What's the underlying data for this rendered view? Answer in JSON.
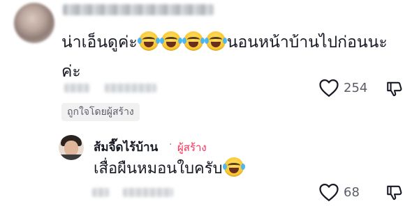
{
  "comment": {
    "text_before_emojis": "น่าเอ็นดูค่ะ",
    "text_after_emojis": "นอนหน้าบ้านไปก่อนนะค่ะ",
    "emoji_count": 4,
    "emoji_icon": "face-with-tears-of-joy-icon",
    "like_count": "254",
    "liked_by_creator_label": "ถูกใจโดยผู้สร้าง"
  },
  "reply": {
    "author_name": "ส้มจี๊ดไร้บ้าน",
    "separator": "·",
    "creator_badge": "ผู้สร้าง",
    "text": "เสื่อผืนหมอนใบครับ",
    "emoji_icon": "face-with-tears-of-joy-icon",
    "like_count": "68"
  },
  "colors": {
    "text_primary": "#161823",
    "text_secondary": "#5a5d66",
    "creator_badge": "#fe2c55",
    "badge_bg": "#f1f1f2"
  }
}
